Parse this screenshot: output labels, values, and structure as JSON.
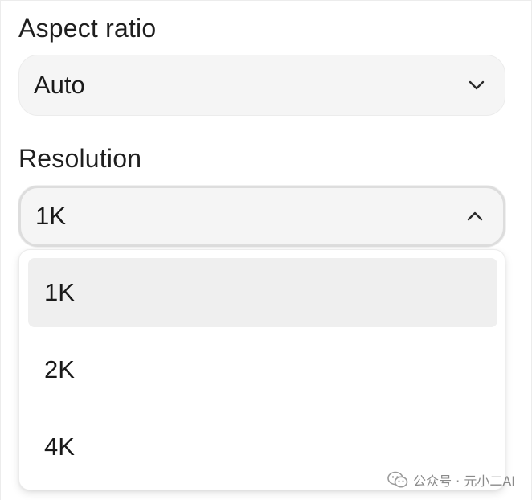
{
  "aspect_ratio": {
    "label": "Aspect ratio",
    "value": "Auto",
    "chevron": "chevron-down-icon"
  },
  "resolution": {
    "label": "Resolution",
    "value": "1K",
    "chevron": "chevron-up-icon",
    "options": [
      {
        "label": "1K",
        "selected": true
      },
      {
        "label": "2K",
        "selected": false
      },
      {
        "label": "4K",
        "selected": false
      }
    ]
  },
  "watermark": {
    "text": "公众号 · 元小二AI",
    "icon": "wechat-icon"
  }
}
